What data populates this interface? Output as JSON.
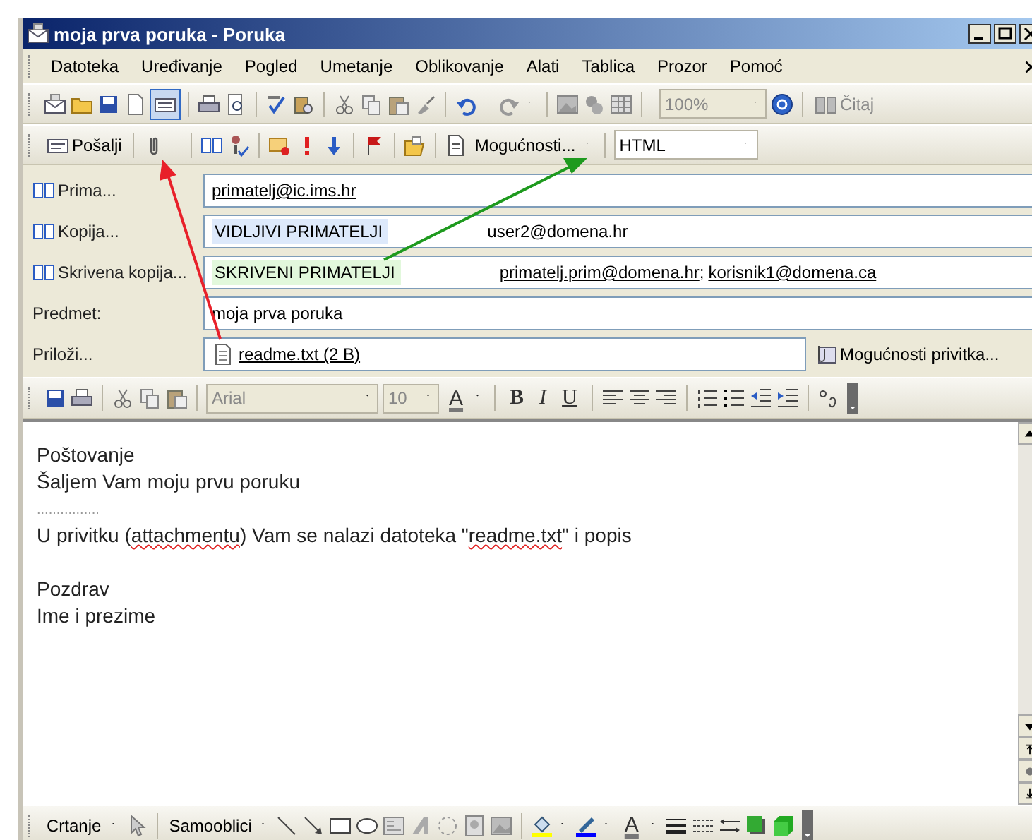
{
  "window": {
    "title": "moja prva poruka - Poruka"
  },
  "menu": [
    "Datoteka",
    "Uređivanje",
    "Pogled",
    "Umetanje",
    "Oblikovanje",
    "Alati",
    "Tablica",
    "Prozor",
    "Pomoć"
  ],
  "standard_toolbar": {
    "zoom": "100%",
    "read_button": "Čitaj"
  },
  "message_toolbar": {
    "send_button": "Pošalji",
    "options_button": "Mogućnosti...",
    "format": "HTML"
  },
  "fields": [
    {
      "label": "Prima...",
      "kind": "button",
      "segments": [
        {
          "text": "primatelj@ic.ims.hr",
          "kind": "address"
        }
      ]
    },
    {
      "label": "Kopija...",
      "kind": "button",
      "segments": [
        {
          "text": "VIDLJIVI PRIMATELJI",
          "kind": "note",
          "color": "#dde9fb"
        },
        {
          "text": "user2@domena.hr",
          "kind": "plain"
        }
      ]
    },
    {
      "label": "Skrivena kopija...",
      "kind": "button",
      "segments": [
        {
          "text": "SKRIVENI PRIMATELJI",
          "kind": "note",
          "color": "#e2f8dc"
        },
        {
          "text": "primatelj.prim@domena.hr",
          "kind": "address"
        },
        {
          "text": ";",
          "kind": "plain"
        },
        {
          "text": "korisnik1@domena.ca",
          "kind": "address"
        }
      ]
    },
    {
      "label": "Predmet:",
      "kind": "plain",
      "segments": [
        {
          "text": "moja prva poruka",
          "kind": "plain"
        }
      ]
    },
    {
      "label": "Priloži...",
      "kind": "attachment",
      "segments": [
        {
          "text": "readme.txt (2 B)",
          "kind": "file"
        }
      ]
    }
  ],
  "attachment_options": "Mogućnosti privitka...",
  "formatting_toolbar": {
    "font": "Arial",
    "size": "10",
    "font_color": "A",
    "styles": [
      "B",
      "I",
      "U"
    ]
  },
  "body": [
    {
      "kind": "text",
      "parts": [
        {
          "text": "Poštovanje",
          "misspelled": false
        }
      ]
    },
    {
      "kind": "text",
      "parts": [
        {
          "text": "Šaljem Vam moju prvu poruku",
          "misspelled": false
        }
      ]
    },
    {
      "kind": "dots",
      "text": "................"
    },
    {
      "kind": "text",
      "parts": [
        {
          "text": "U privitku (",
          "misspelled": false
        },
        {
          "text": "attachmentu",
          "misspelled": true
        },
        {
          "text": ") Vam se nalazi datoteka \"",
          "misspelled": false
        },
        {
          "text": "readme.txt",
          "misspelled": true
        },
        {
          "text": "\" i popis",
          "misspelled": false
        }
      ]
    },
    {
      "kind": "blank"
    },
    {
      "kind": "text",
      "parts": [
        {
          "text": "Pozdrav",
          "misspelled": false
        }
      ]
    },
    {
      "kind": "text",
      "parts": [
        {
          "text": "Ime i prezime",
          "misspelled": false
        }
      ]
    }
  ],
  "drawing_toolbar": {
    "draw_menu": "Crtanje",
    "shapes_menu": "Samooblici",
    "font_color": "A"
  }
}
